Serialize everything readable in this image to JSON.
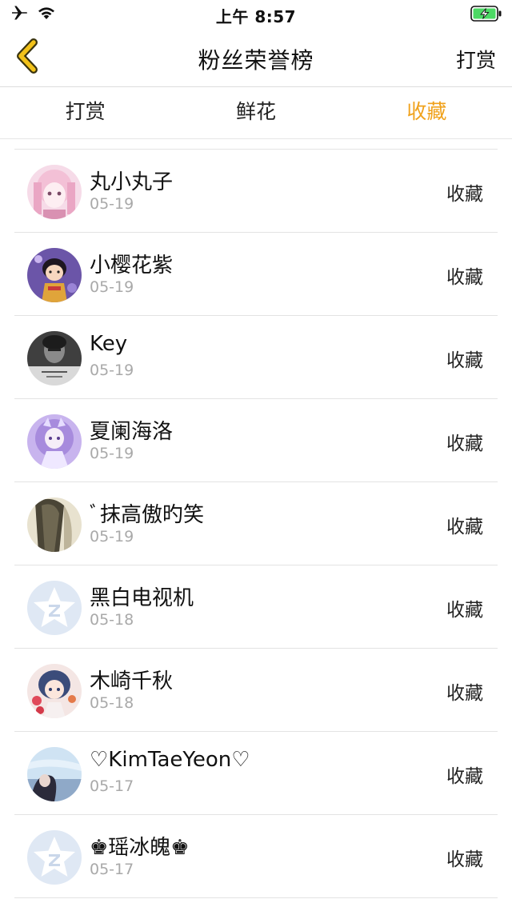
{
  "status_bar": {
    "time": "上午 8:57",
    "airplane_icon": "airplane-icon",
    "wifi_icon": "wifi-icon",
    "battery_icon": "battery-charging-icon",
    "battery_color": "#4cd964"
  },
  "nav": {
    "back_icon": "chevron-left-icon",
    "title": "粉丝荣誉榜",
    "right_label": "打赏",
    "accent_color": "#f2c21a"
  },
  "tabs": [
    {
      "label": "打赏",
      "active": false
    },
    {
      "label": "鲜花",
      "active": false
    },
    {
      "label": "收藏",
      "active": true
    }
  ],
  "active_tab_color": "#f0a21c",
  "list": [
    {
      "name": "丸小丸子",
      "date": "05-19",
      "action": "收藏",
      "avatar": "pink-anime-girl-avatar"
    },
    {
      "name": "小樱花紫",
      "date": "05-19",
      "action": "收藏",
      "avatar": "maruko-kimono-avatar"
    },
    {
      "name": "Key",
      "date": "05-19",
      "action": "收藏",
      "avatar": "grayscale-portrait-avatar"
    },
    {
      "name": "夏阑海洛",
      "date": "05-19",
      "action": "收藏",
      "avatar": "purple-anime-avatar"
    },
    {
      "name": "ﾞ抹高傲旳笑",
      "date": "05-19",
      "action": "收藏",
      "avatar": "sepia-hair-avatar"
    },
    {
      "name": "黑白电视机",
      "date": "05-18",
      "action": "收藏",
      "avatar": "default-qq-avatar"
    },
    {
      "name": "木崎千秋",
      "date": "05-18",
      "action": "收藏",
      "avatar": "anime-girl-flowers-avatar"
    },
    {
      "name": "♡KimTaeYeon♡",
      "date": "05-17",
      "action": "收藏",
      "avatar": "blue-sky-portrait-avatar"
    },
    {
      "name": "♚瑶冰魄♚",
      "date": "05-17",
      "action": "收藏",
      "avatar": "default-qq-avatar"
    }
  ]
}
